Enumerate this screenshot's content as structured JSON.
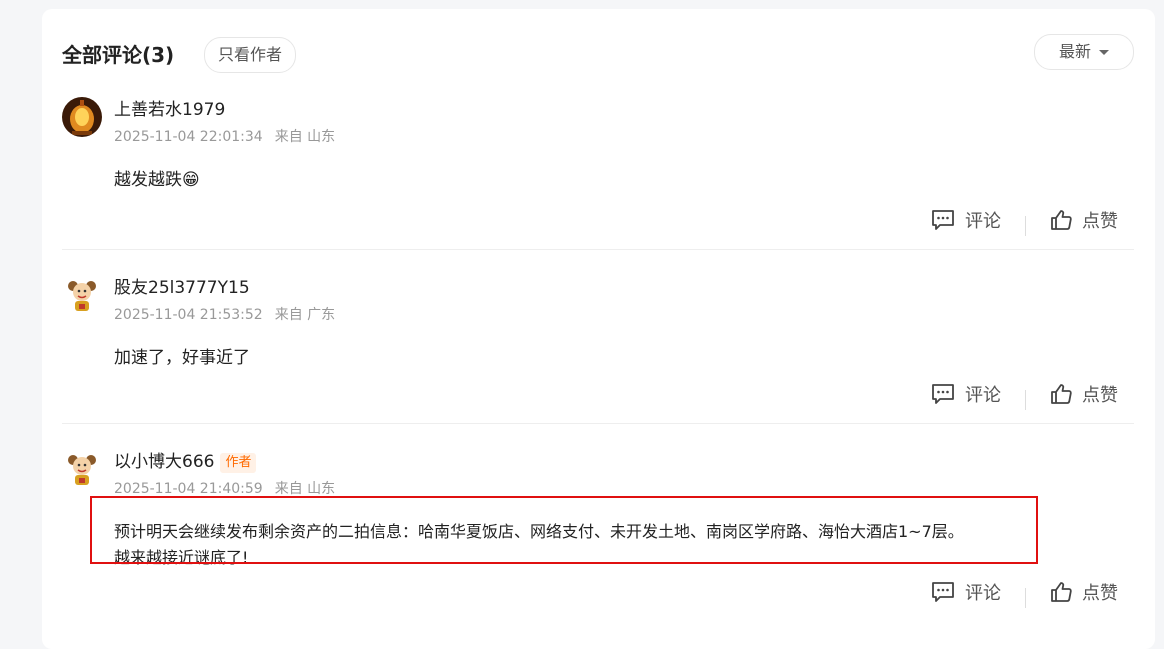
{
  "header": {
    "title": "全部评论(3)",
    "author_only": "只看作者",
    "sort_label": "最新"
  },
  "comments": [
    {
      "user": "上善若水1979",
      "time": "2025-11-04 22:01:34",
      "location": "来自 山东",
      "text": "越发越跌",
      "emoji": "😁",
      "reply_label": "评论",
      "like_label": "点赞"
    },
    {
      "user": "股友25l3777Y15",
      "time": "2025-11-04 21:53:52",
      "location": "来自 广东",
      "text": "加速了，好事近了",
      "reply_label": "评论",
      "like_label": "点赞"
    },
    {
      "user": "以小博大666",
      "badge": "作者",
      "time": "2025-11-04 21:40:59",
      "location": "来自 山东",
      "text_line1": "预计明天会继续发布剩余资产的二拍信息：哈南华夏饭店、网络支付、未开发土地、南岗区学府路、海怡大酒店1~7层。",
      "text_line2": "越来越接近谜底了!",
      "reply_label": "评论",
      "like_label": "点赞"
    }
  ],
  "colors": {
    "highlight_border": "#e01010",
    "author_badge": "#ff6a00"
  }
}
